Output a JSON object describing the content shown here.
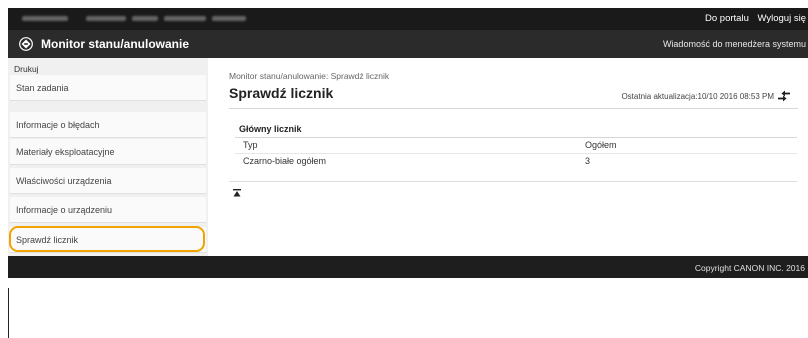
{
  "topbar": {
    "portal_link": "Do portalu",
    "logout_link": "Wyloguj się"
  },
  "titlebar": {
    "app_title": "Monitor stanu/anulowanie",
    "admin_message": "Wiadomość do menedżera systemu"
  },
  "sidebar": {
    "heading": "Drukuj",
    "items": [
      {
        "label": "Stan zadania"
      },
      {
        "label": "Informacje o błędach"
      },
      {
        "label": "Materiały eksploatacyjne"
      },
      {
        "label": "Właściwości urządzenia"
      },
      {
        "label": "Informacje o urządzeniu"
      },
      {
        "label": "Sprawdź licznik"
      }
    ]
  },
  "main": {
    "breadcrumb": "Monitor stanu/anulowanie: Sprawdź licznik",
    "title": "Sprawdź licznik",
    "last_update": "Ostatnia aktualizacja:10/10 2016 08:53 PM",
    "counter": {
      "heading": "Główny licznik",
      "rows": [
        {
          "label": "Typ",
          "value": "Ogółem"
        },
        {
          "label": "Czarno-białe ogółem",
          "value": "3"
        }
      ]
    }
  },
  "footer": {
    "copyright": "Copyright CANON INC. 2016"
  }
}
